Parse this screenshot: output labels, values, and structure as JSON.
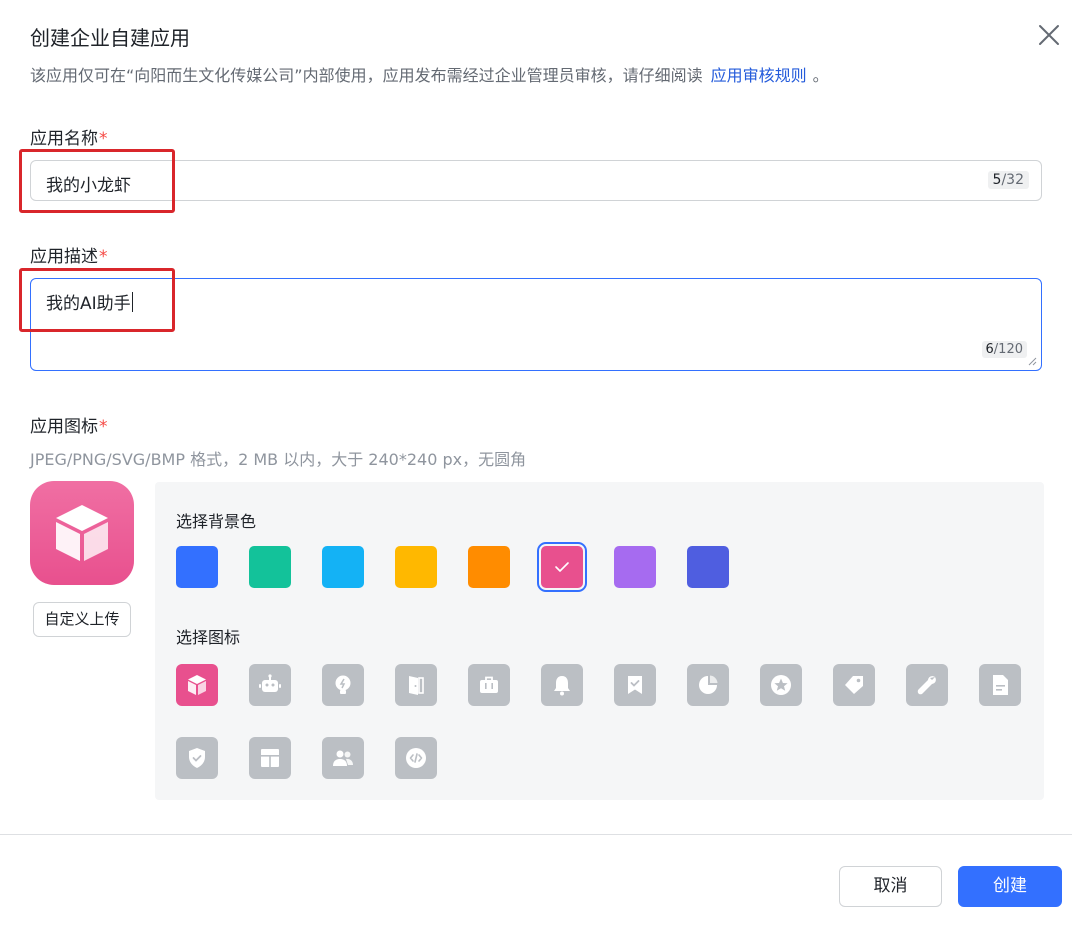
{
  "dialog": {
    "title": "创建企业自建应用",
    "subtitle": "该应用仅可在“向阳而生文化传媒公司”内部使用，应用发布需经过企业管理员审核，请仔细阅读",
    "rules_link": "应用审核规则",
    "subtitle_end": "。"
  },
  "name_field": {
    "label": "应用名称",
    "required_mark": "*",
    "value": "我的小龙虾",
    "count_current": "5",
    "count_max": "/32"
  },
  "desc_field": {
    "label": "应用描述",
    "required_mark": "*",
    "value": "我的AI助手",
    "count_current": "6",
    "count_max": "/120"
  },
  "icon_field": {
    "label": "应用图标",
    "required_mark": "*",
    "hint": "JPEG/PNG/SVG/BMP 格式，2 MB 以内，大于 240*240 px，无圆角",
    "upload_label": "自定义上传",
    "bg_section_label": "选择背景色",
    "icon_section_label": "选择图标",
    "bg_colors": [
      "#3370ff",
      "#13c29a",
      "#14b2f5",
      "#ffb800",
      "#ff8c00",
      "#e8508e",
      "#a66bf0",
      "#4f5ee0"
    ],
    "selected_bg_index": 5,
    "icons": [
      "cube-icon",
      "robot-icon",
      "lightbulb-icon",
      "door-icon",
      "briefcase-icon",
      "bell-icon",
      "bookmark-check-icon",
      "pie-chart-icon",
      "star-icon",
      "tag-icon",
      "wrench-icon",
      "document-icon",
      "shield-check-icon",
      "layout-icon",
      "users-icon",
      "code-icon"
    ],
    "selected_icon_index": 0
  },
  "footer": {
    "cancel_label": "取消",
    "create_label": "创建"
  },
  "colors": {
    "primary": "#3370ff",
    "required": "#f54a45",
    "link": "#245bdb",
    "highlight_box": "#d9262b",
    "icon_grey": "#bbbfc4"
  }
}
